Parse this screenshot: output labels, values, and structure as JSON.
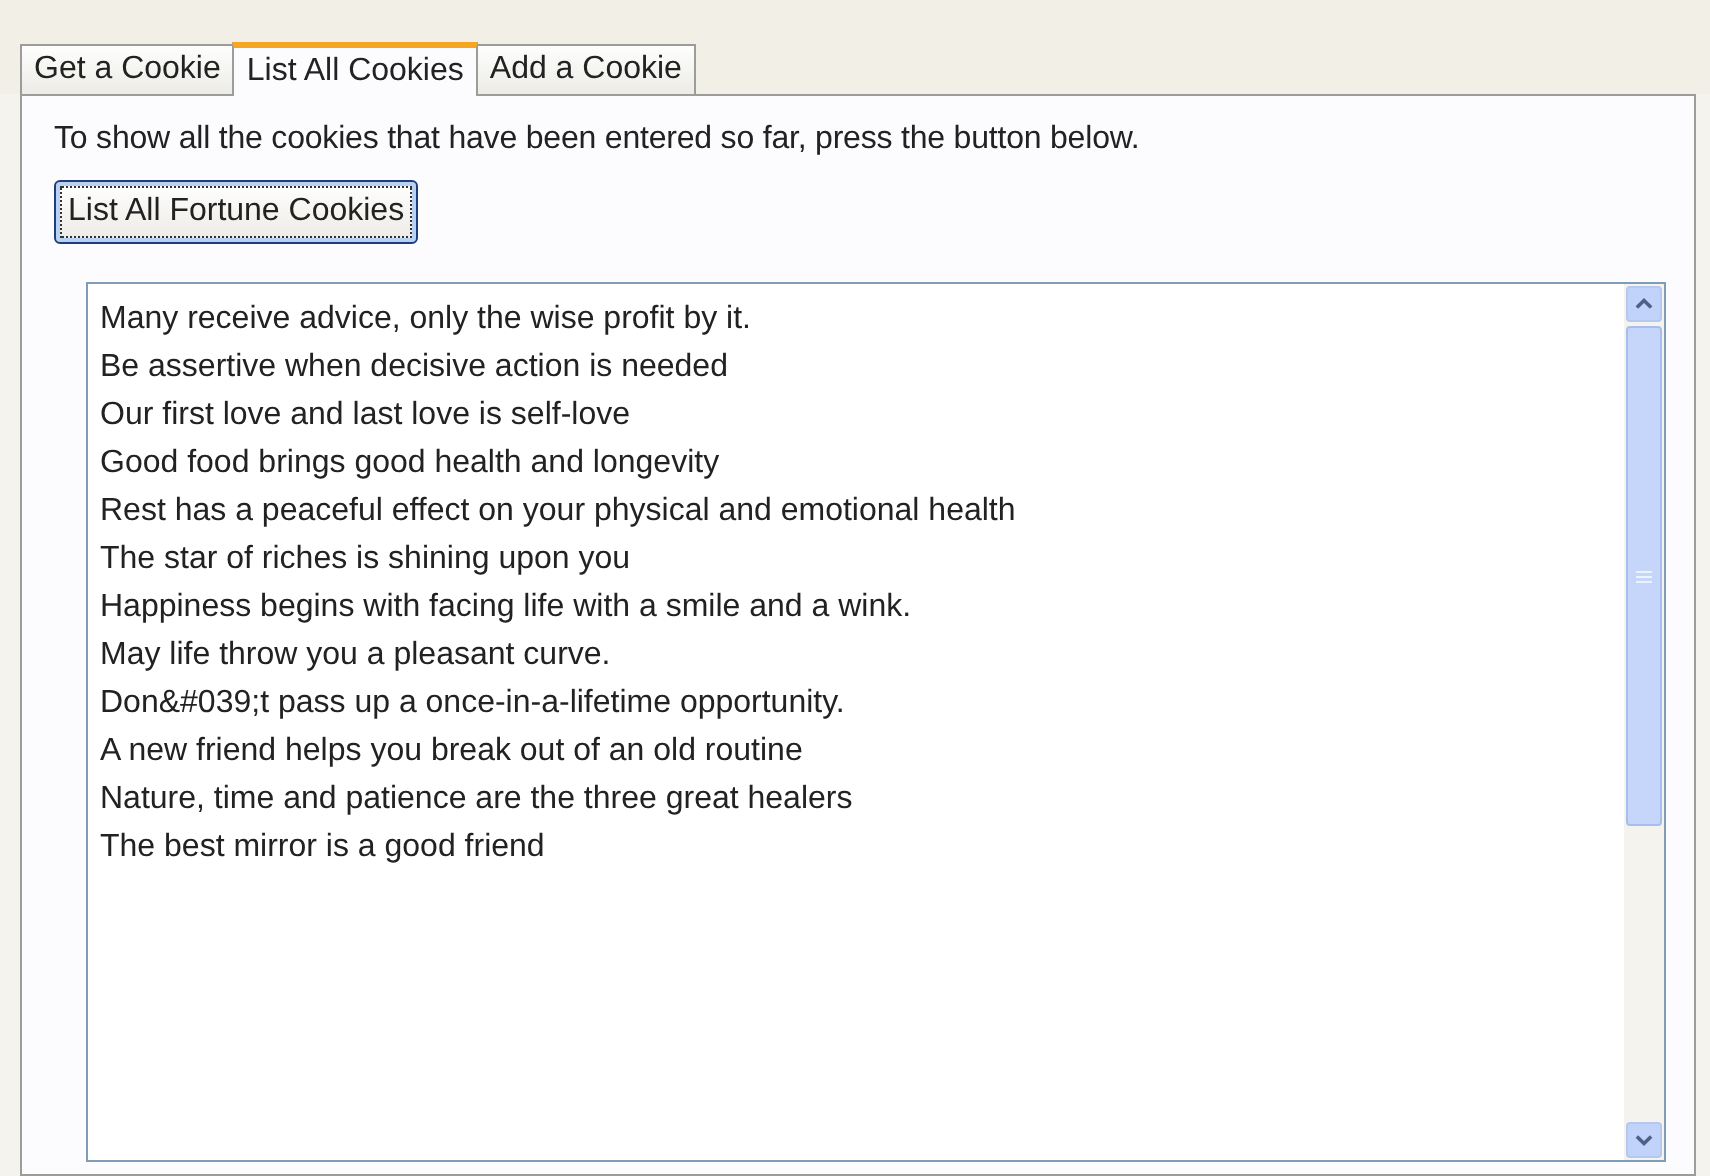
{
  "tabs": [
    {
      "label": "Get a Cookie",
      "selected": false
    },
    {
      "label": "List All Cookies",
      "selected": true
    },
    {
      "label": "Add a Cookie",
      "selected": false
    }
  ],
  "instructions": "To show all the cookies that have been entered so far, press the button below.",
  "list_button": {
    "label": "List All Fortune Cookies",
    "focused": true
  },
  "cookie_list": {
    "items": [
      "Many receive advice, only the wise profit by it.",
      "Be assertive when decisive action is needed",
      "Our first love and last love is self-love",
      "Good food brings good health and longevity",
      "Rest has a peaceful effect on your physical and emotional health",
      "The star of riches is shining upon you",
      "Happiness begins with facing life with a smile and a wink.",
      "May life throw you a pleasant curve.",
      "Don&#039;t pass up a once-in-a-lifetime opportunity.",
      "A new friend helps you break out of an old routine",
      "Nature, time and patience are the three great healers",
      "The best mirror is a good friend"
    ]
  }
}
